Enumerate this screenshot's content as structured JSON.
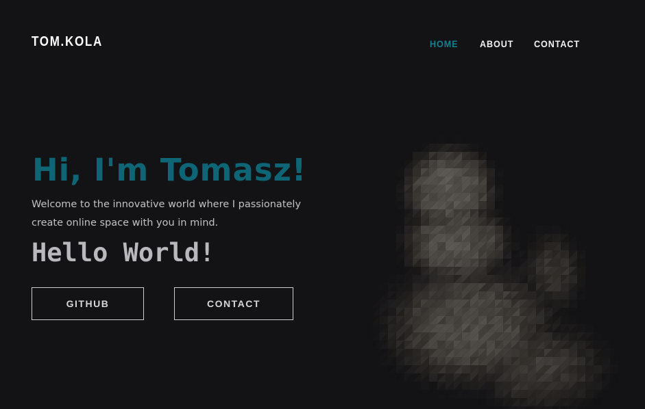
{
  "header": {
    "logo": "TOM.KOLA",
    "nav": [
      {
        "label": "HOME",
        "active": true
      },
      {
        "label": "ABOUT",
        "active": false
      },
      {
        "label": "CONTACT",
        "active": false
      }
    ]
  },
  "hero": {
    "title": "Hi, I'm Tomasz!",
    "subtitle": "Welcome to the innovative world where I passionately create online space with you in mind.",
    "hello": "Hello World!",
    "buttons": {
      "github": "GITHUB",
      "contact": "CONTACT"
    }
  },
  "colors": {
    "background": "#131316",
    "accent": "#0e6575",
    "nav_active": "#12808f",
    "text": "#e8e8ea"
  },
  "portrait": {
    "icon": "low-poly-portrait-image"
  }
}
